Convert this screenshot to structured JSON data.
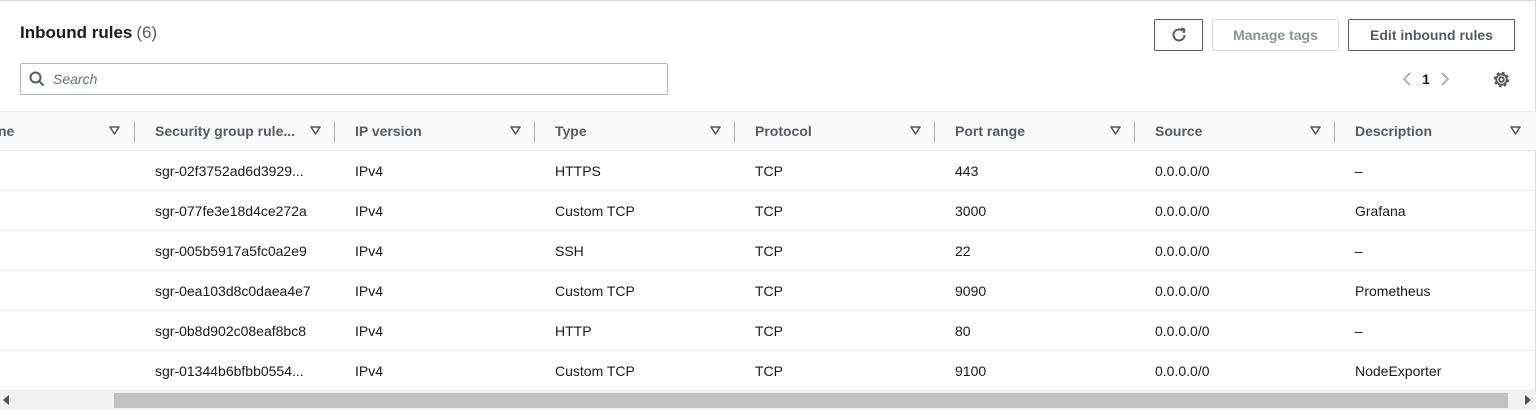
{
  "header": {
    "title": "Inbound rules",
    "count": "(6)"
  },
  "toolbar": {
    "manage_tags_label": "Manage tags",
    "edit_label": "Edit inbound rules"
  },
  "search": {
    "placeholder": "Search",
    "value": ""
  },
  "pagination": {
    "current_page": "1"
  },
  "table": {
    "columns": [
      {
        "label": "ne"
      },
      {
        "label": "Security group rule..."
      },
      {
        "label": "IP version"
      },
      {
        "label": "Type"
      },
      {
        "label": "Protocol"
      },
      {
        "label": "Port range"
      },
      {
        "label": "Source"
      },
      {
        "label": "Description"
      }
    ],
    "rows": [
      {
        "name": "",
        "rule_id": "sgr-02f3752ad6d3929...",
        "ip_version": "IPv4",
        "type": "HTTPS",
        "protocol": "TCP",
        "port_range": "443",
        "source": "0.0.0.0/0",
        "description": "–"
      },
      {
        "name": "",
        "rule_id": "sgr-077fe3e18d4ce272a",
        "ip_version": "IPv4",
        "type": "Custom TCP",
        "protocol": "TCP",
        "port_range": "3000",
        "source": "0.0.0.0/0",
        "description": "Grafana"
      },
      {
        "name": "",
        "rule_id": "sgr-005b5917a5fc0a2e9",
        "ip_version": "IPv4",
        "type": "SSH",
        "protocol": "TCP",
        "port_range": "22",
        "source": "0.0.0.0/0",
        "description": "–"
      },
      {
        "name": "",
        "rule_id": "sgr-0ea103d8c0daea4e7",
        "ip_version": "IPv4",
        "type": "Custom TCP",
        "protocol": "TCP",
        "port_range": "9090",
        "source": "0.0.0.0/0",
        "description": "Prometheus"
      },
      {
        "name": "",
        "rule_id": "sgr-0b8d902c08eaf8bc8",
        "ip_version": "IPv4",
        "type": "HTTP",
        "protocol": "TCP",
        "port_range": "80",
        "source": "0.0.0.0/0",
        "description": "–"
      },
      {
        "name": "",
        "rule_id": "sgr-01344b6bfbb0554...",
        "ip_version": "IPv4",
        "type": "Custom TCP",
        "protocol": "TCP",
        "port_range": "9100",
        "source": "0.0.0.0/0",
        "description": "NodeExporter"
      }
    ]
  },
  "icons": {
    "refresh": "refresh-icon",
    "search": "search-icon",
    "prev": "chevron-left-icon",
    "next": "chevron-right-icon",
    "settings": "gear-icon",
    "sort": "caret-down-icon"
  },
  "colors": {
    "text": "#16191f",
    "muted": "#545b64",
    "border": "#aab7b8",
    "disabled": "#879596"
  }
}
